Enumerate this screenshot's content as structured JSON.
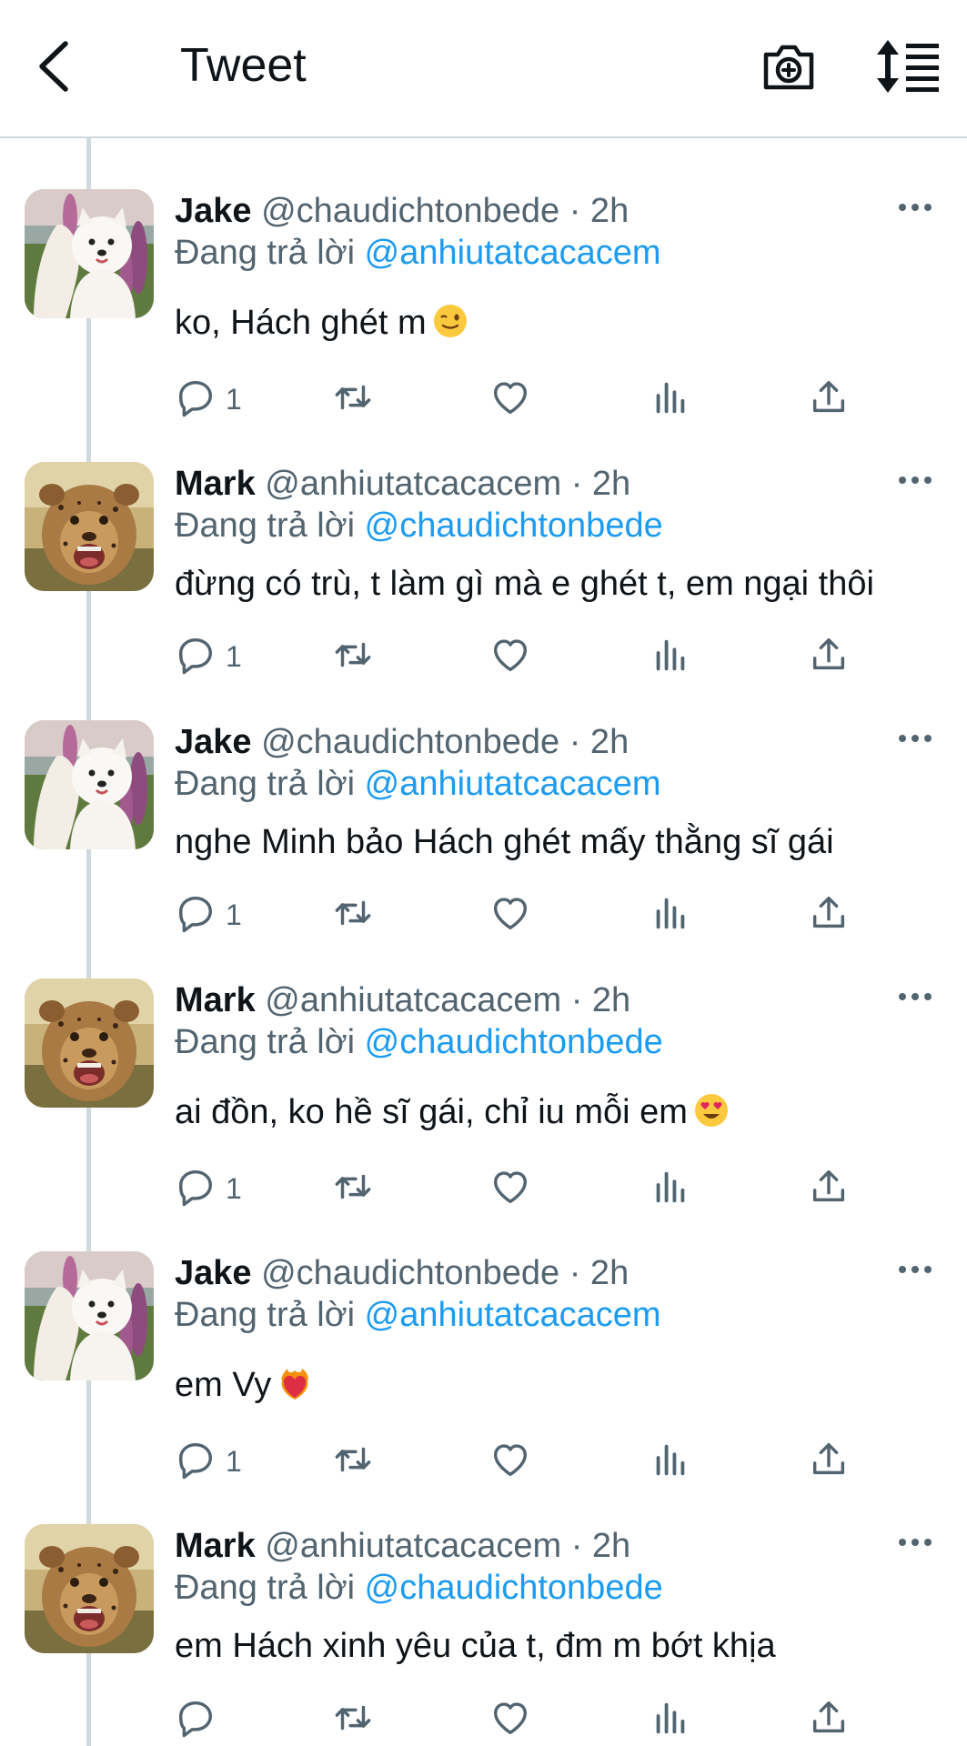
{
  "header": {
    "title": "Tweet",
    "back_icon": "chevron-left-icon",
    "camera_icon": "camera-plus-icon",
    "sort_icon": "sort-list-icon"
  },
  "colors": {
    "link": "#1d9bf0",
    "secondary_text": "#536471",
    "primary_text": "#0f1419",
    "divider": "#cfd9de"
  },
  "tweets": [
    {
      "name": "Jake",
      "handle": "@chaudichtonbede",
      "time": "· 2h",
      "reply_prefix": "Đang trả lời",
      "reply_to": "@anhiutatcacacem",
      "text": "ko, Hách ghét m",
      "emoji": "winking-face",
      "reply_count": "1",
      "avatar": "white-dog-avatar"
    },
    {
      "name": "Mark",
      "handle": "@anhiutatcacacem",
      "time": "· 2h",
      "reply_prefix": "Đang trả lời",
      "reply_to": "@chaudichtonbede",
      "text": "đừng có trù, t làm gì mà e ghét t, em ngại thôi",
      "emoji": "",
      "reply_count": "1",
      "avatar": "cheetah-cub-avatar"
    },
    {
      "name": "Jake",
      "handle": "@chaudichtonbede",
      "time": "· 2h",
      "reply_prefix": "Đang trả lời",
      "reply_to": "@anhiutatcacacem",
      "text": "nghe Minh bảo Hách ghét mấy thằng sĩ gái",
      "emoji": "",
      "reply_count": "1",
      "avatar": "white-dog-avatar"
    },
    {
      "name": "Mark",
      "handle": "@anhiutatcacacem",
      "time": "· 2h",
      "reply_prefix": "Đang trả lời",
      "reply_to": "@chaudichtonbede",
      "text": "ai đồn, ko hề sĩ gái, chỉ iu mỗi em",
      "emoji": "heart-eyes-face",
      "reply_count": "1",
      "avatar": "cheetah-cub-avatar"
    },
    {
      "name": "Jake",
      "handle": "@chaudichtonbede",
      "time": "· 2h",
      "reply_prefix": "Đang trả lời",
      "reply_to": "@anhiutatcacacem",
      "text": "em Vy",
      "emoji": "heart-on-fire",
      "reply_count": "1",
      "avatar": "white-dog-avatar"
    },
    {
      "name": "Mark",
      "handle": "@anhiutatcacacem",
      "time": "· 2h",
      "reply_prefix": "Đang trả lời",
      "reply_to": "@chaudichtonbede",
      "text": "em Hách xinh yêu của t, đm m bớt khịa",
      "emoji": "",
      "reply_count": "",
      "avatar": "cheetah-cub-avatar"
    }
  ]
}
